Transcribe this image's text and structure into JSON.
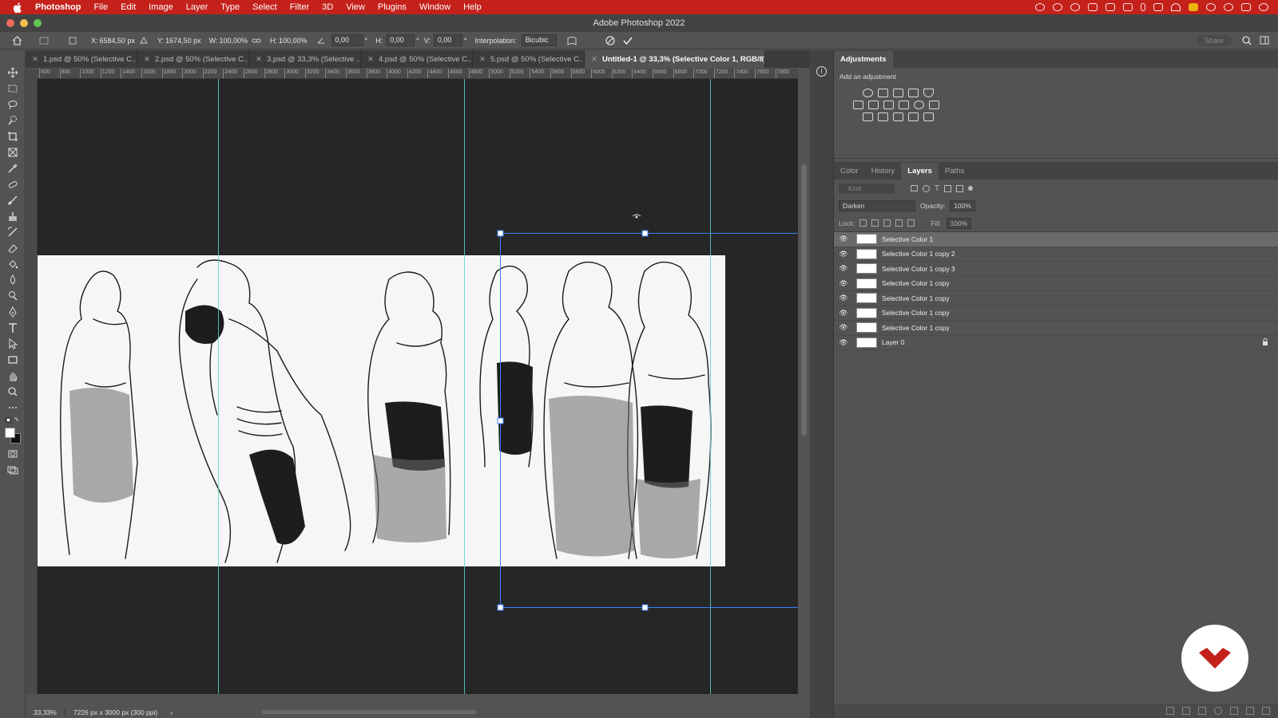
{
  "menubar": {
    "items": [
      "Photoshop",
      "File",
      "Edit",
      "Image",
      "Layer",
      "Type",
      "Select",
      "Filter",
      "3D",
      "View",
      "Plugins",
      "Window",
      "Help"
    ]
  },
  "window": {
    "title": "Adobe Photoshop 2022"
  },
  "options": {
    "x_label": "X:",
    "x_value": "6584,50 px",
    "y_label": "Y:",
    "y_value": "1674,50 px",
    "w_label": "W:",
    "w_value": "100,00%",
    "h_label": "H:",
    "h_value": "100,00%",
    "angle_value": "0,00",
    "hskew_label": "H:",
    "hskew_value": "0,00",
    "vskew_label": "V:",
    "vskew_value": "0,00",
    "deg": "°",
    "interp_label": "Interpolation:",
    "interp_value": "Bicubic",
    "share_label": "Share"
  },
  "tabs": [
    "1.psd @ 50% (Selective C...",
    "2.psd @ 50% (Selective C...",
    "3.psd @ 33,3% (Selective ...",
    "4.psd @ 50% (Selective C...",
    "5.psd @ 50% (Selective C...",
    "Untitled-1 @ 33,3% (Selective Color 1, RGB/8) *"
  ],
  "ruler_labels": [
    "600",
    "800",
    "1000",
    "1200",
    "1400",
    "1600",
    "1800",
    "2000",
    "2200",
    "2400",
    "2600",
    "2800",
    "3000",
    "3200",
    "3400",
    "3600",
    "3800",
    "4000",
    "4200",
    "4400",
    "4600",
    "4800",
    "5000",
    "5200",
    "5400",
    "5600",
    "5800",
    "6000",
    "6200",
    "6400",
    "6600",
    "6800",
    "7000",
    "7200",
    "7400",
    "7600",
    "7800"
  ],
  "status": {
    "zoom": "33,33%",
    "doc_size": "7226 px x 3000 px (300 ppi)",
    "arrow": "›"
  },
  "adjustments": {
    "title": "Adjustments",
    "subtitle": "Add an adjustment"
  },
  "panel_tabs": [
    "Color",
    "History",
    "Layers",
    "Paths"
  ],
  "layers_panel": {
    "kind_placeholder": "Kind",
    "blend_mode": "Darken",
    "opacity_label": "Opacity:",
    "opacity_value": "100%",
    "lock_label": "Lock:",
    "fill_label": "Fill:",
    "fill_value": "100%",
    "layers": [
      "Selective Color 1",
      "Selective Color 1 copy 2",
      "Selective Color 1 copy 3",
      "Selective Color 1 copy",
      "Selective Color 1 copy",
      "Selective Color 1 copy",
      "Selective Color 1 copy",
      "Layer 0"
    ]
  },
  "colors": {
    "menubar": "#c4211b",
    "guide": "#5ad6c9",
    "selection": "#3b82f6",
    "logo": "#c4211b"
  }
}
